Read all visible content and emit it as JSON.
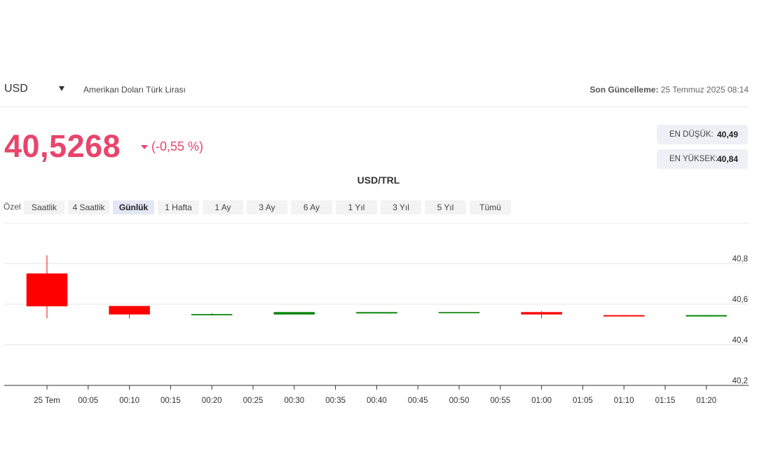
{
  "header": {
    "currency_code": "USD",
    "pair_name": "Amerikan Doları Türk Lirası",
    "update_label": "Son Güncelleme:",
    "update_value": "25 Temmuz 2025 08:14"
  },
  "quote": {
    "price": "40,5268",
    "change": "(-0,55 %)",
    "low_label": "EN DÜŞÜK:",
    "low_value": "40,49",
    "high_label": "EN YÜKSEK:",
    "high_value": "40,84"
  },
  "colors": {
    "accent": "#e8456b",
    "up": "#008000",
    "down": "#ff0000"
  },
  "ranges": {
    "custom_label": "Özel",
    "buttons": [
      "Saatlik",
      "4 Saatlik",
      "Günlük",
      "1 Hafta",
      "1 Ay",
      "3 Ay",
      "6 Ay",
      "1 Yıl",
      "3 Yıl",
      "5 Yıl",
      "Tümü"
    ],
    "active": "Günlük"
  },
  "chart_data": {
    "type": "candlestick",
    "title": "USD/TRL",
    "x_ticks": [
      "25 Tem",
      "00:05",
      "00:10",
      "00:15",
      "00:20",
      "00:25",
      "00:30",
      "00:35",
      "00:40",
      "00:45",
      "00:50",
      "00:55",
      "01:00",
      "01:05",
      "01:10",
      "01:15",
      "01:20"
    ],
    "y_ticks": [
      "40,8",
      "40,6",
      "40,4",
      "40,2"
    ],
    "ylim": [
      40.2,
      40.82
    ],
    "grid": true,
    "candles": [
      {
        "time": "25 Tem",
        "open": 40.75,
        "high": 40.84,
        "low": 40.53,
        "close": 40.59
      },
      {
        "time": "00:10",
        "open": 40.59,
        "high": 40.59,
        "low": 40.53,
        "close": 40.55
      },
      {
        "time": "00:20",
        "open": 40.55,
        "high": 40.555,
        "low": 40.545,
        "close": 40.55
      },
      {
        "time": "00:30",
        "open": 40.55,
        "high": 40.56,
        "low": 40.55,
        "close": 40.56
      },
      {
        "time": "00:40",
        "open": 40.555,
        "high": 40.56,
        "low": 40.555,
        "close": 40.56
      },
      {
        "time": "00:50",
        "open": 40.558,
        "high": 40.56,
        "low": 40.558,
        "close": 40.56
      },
      {
        "time": "01:00",
        "open": 40.56,
        "high": 40.565,
        "low": 40.53,
        "close": 40.55
      },
      {
        "time": "01:10",
        "open": 40.545,
        "high": 40.547,
        "low": 40.54,
        "close": 40.54
      },
      {
        "time": "01:20",
        "open": 40.54,
        "high": 40.545,
        "low": 40.54,
        "close": 40.545
      }
    ]
  }
}
